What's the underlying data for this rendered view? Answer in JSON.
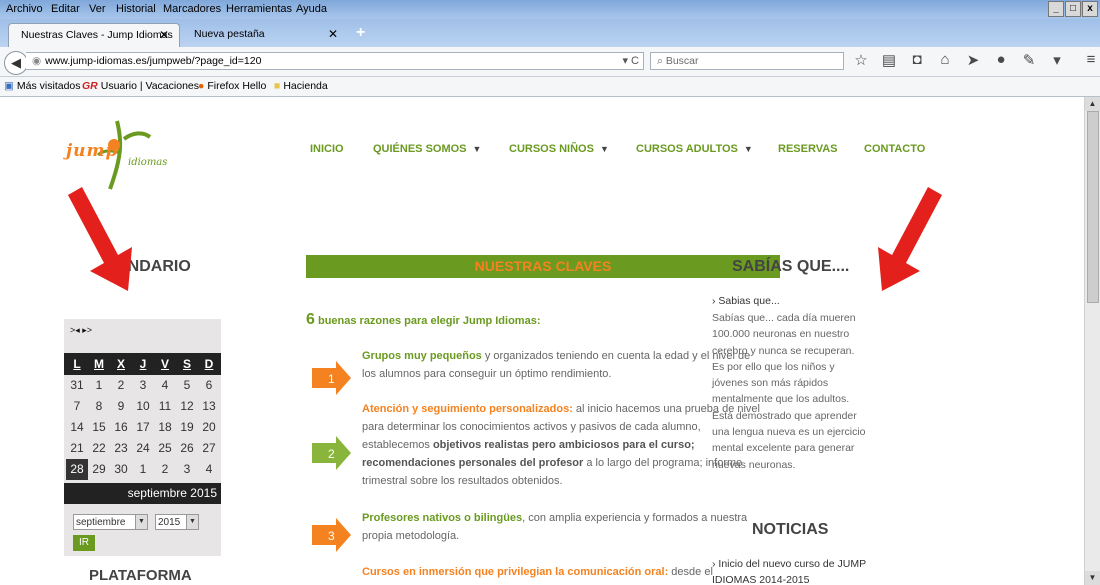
{
  "menubar": {
    "items": [
      "Archivo",
      "Editar",
      "Ver",
      "Historial",
      "Marcadores",
      "Herramientas",
      "Ayuda"
    ],
    "window_buttons": [
      "_",
      "□",
      "x"
    ]
  },
  "tabs": [
    {
      "label": "Nuestras Claves - Jump Idiomas",
      "active": true
    },
    {
      "label": "Nueva pestaña",
      "active": false
    }
  ],
  "navbar": {
    "url": "www.jump-idiomas.es/jumpweb/?page_id=120",
    "search_placeholder": "Buscar"
  },
  "bookmarks": [
    {
      "label": "Más visitados",
      "icon": "page-icon"
    },
    {
      "label": "Usuario | Vacaciones",
      "icon": "gr-icon"
    },
    {
      "label": "Firefox Hello",
      "icon": "firefox-icon"
    },
    {
      "label": "Hacienda",
      "icon": "folder-icon"
    }
  ],
  "site": {
    "logo_jump": "jump",
    "logo_idiomas": "idiomas",
    "nav": [
      "INICIO",
      "QUIÉNES SOMOS",
      "CURSOS NIÑOS",
      "CURSOS ADULTOS",
      "RESERVAS",
      "CONTACTO"
    ],
    "calendar_title": "ENDARIO",
    "calendar": {
      "controls": ">◂ ▸>",
      "days": [
        "L",
        "M",
        "X",
        "J",
        "V",
        "S",
        "D"
      ],
      "weeks": [
        [
          "31",
          "1",
          "2",
          "3",
          "4",
          "5",
          "6"
        ],
        [
          "7",
          "8",
          "9",
          "10",
          "11",
          "12",
          "13"
        ],
        [
          "14",
          "15",
          "16",
          "17",
          "18",
          "19",
          "20"
        ],
        [
          "21",
          "22",
          "23",
          "24",
          "25",
          "26",
          "27"
        ],
        [
          "28",
          "29",
          "30",
          "1",
          "2",
          "3",
          "4"
        ]
      ],
      "selected_day": "28",
      "month_label": "septiembre 2015",
      "month_select": "septiembre",
      "year_select": "2015",
      "go_button": "IR"
    },
    "plataforma": "PLATAFORMA",
    "banner": "NUESTRAS CLAVES",
    "intro_num": "6",
    "intro_text": "buenas razones para elegir Jump Idiomas:",
    "items": [
      {
        "num": "1",
        "title": "Grupos muy pequeños",
        "rest": " y organizados teniendo en cuenta la edad y el nivel de los alumnos para conseguir un óptimo rendimiento."
      },
      {
        "num": "2",
        "title": "Atención y seguimiento personalizados:",
        "rest_a": " al inicio hacemos una prueba de nivel para determinar los conocimientos activos y pasivos de cada alumno, establecemos ",
        "bold_a": "objetivos realistas pero ambiciosos para el curso;",
        "rest_b": " ",
        "bold_b": "recomendaciones personales del profesor",
        "rest_c": " a lo largo del programa; informe trimestral sobre los resultados obtenidos."
      },
      {
        "num": "3",
        "title": "Profesores nativos o bilingües",
        "rest": ", con amplia experiencia y formados a nuestra propia metodología."
      },
      {
        "title": "Cursos en inmersión que privilegian la comunicación oral:",
        "rest": " desde el"
      }
    ],
    "sabias_title": "SABÍAS QUE....",
    "sabias_link": "›  Sabias que...",
    "sabias_text": "Sabías que... cada día mueren 100.000 neuronas en nuestro cerebro y nunca se recuperan. Es por ello que los niños y jóvenes son más rápidos mentalmente que los adultos. Está demostrado que aprender una lengua nueva es un ejercicio mental excelente para generar nuevas neuronas.",
    "noticias_title": "NOTICIAS",
    "noticias_item": "›  Inicio del nuevo curso de JUMP IDIOMAS 2014-2015"
  },
  "colors": {
    "green": "#6a9a1f",
    "orange": "#f58220",
    "arrow": "#e3201b"
  }
}
